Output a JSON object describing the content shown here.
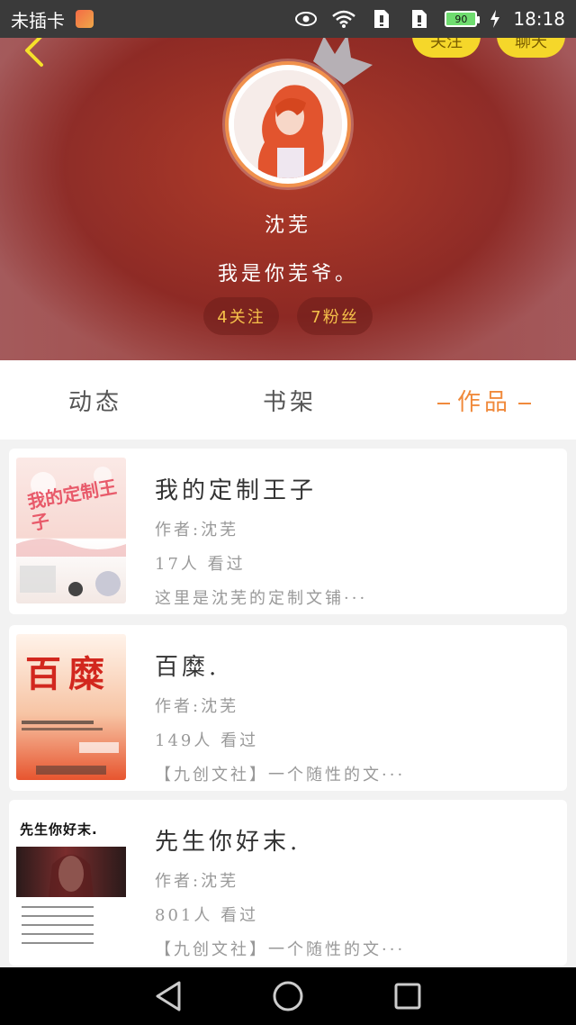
{
  "status_bar": {
    "carrier": "未插卡",
    "battery": "90",
    "time": "18:18",
    "icons": [
      "eye-icon",
      "wifi-icon",
      "sim-icon",
      "sim-icon",
      "charging-icon"
    ]
  },
  "header": {
    "follow_button": "关注",
    "chat_button": "聊天",
    "username": "沈芜",
    "bio": "我是你芜爷。",
    "following_count": "4关注",
    "fans_count": "7粉丝"
  },
  "tabs": [
    {
      "label": "动态",
      "active": false
    },
    {
      "label": "书架",
      "active": false
    },
    {
      "label": "作品",
      "active": true
    }
  ],
  "books": [
    {
      "title": "我的定制王子",
      "author": "作者:沈芜",
      "views": "17人 看过",
      "desc": "这里是沈芜的定制文铺···",
      "cover_text": "我的定制王子"
    },
    {
      "title": "百糜.",
      "author": "作者:沈芜",
      "views": "149人 看过",
      "desc": "【九创文社】一个随性的文···",
      "cover_text": "百糜"
    },
    {
      "title": "先生你好末.",
      "author": "作者:沈芜",
      "views": "801人 看过",
      "desc": "【九创文社】一个随性的文···",
      "cover_text": "先生你好末."
    }
  ],
  "colors": {
    "accent": "#f08a3c",
    "button_yellow": "#f5d72a",
    "stat_text": "#f5c04a"
  }
}
